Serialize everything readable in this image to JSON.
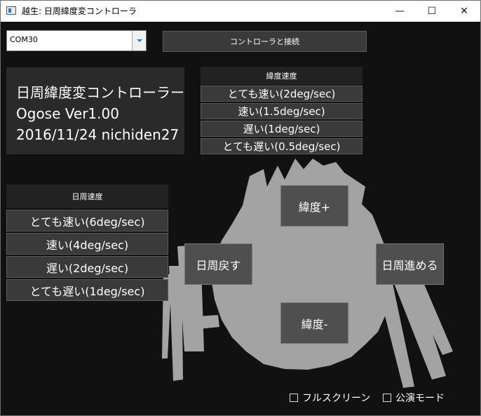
{
  "window": {
    "title": "越生: 日周緯度変コントローラ",
    "controls": {
      "minimize": "—",
      "maximize": "☐",
      "close": "✕"
    }
  },
  "port_select": {
    "value": "COM30"
  },
  "connect": {
    "label": "コントローラと接続"
  },
  "info": {
    "line1": "日周緯度変コントローラー",
    "line2": "Ogose Ver1.00",
    "line3": "2016/11/24 nichiden27"
  },
  "latitude": {
    "heading": "緯度速度",
    "options": [
      "とても速い(2deg/sec)",
      "速い(1.5deg/sec)",
      "遅い(1deg/sec)",
      "とても遅い(0.5deg/sec)"
    ]
  },
  "diurnal": {
    "heading": "日周速度",
    "options": [
      "とても速い(6deg/sec)",
      "速い(4deg/sec)",
      "遅い(2deg/sec)",
      "とても遅い(1deg/sec)"
    ]
  },
  "controls": {
    "lat_plus": "緯度+",
    "lat_minus": "緯度-",
    "day_back": "日周戻す",
    "day_forward": "日周進める"
  },
  "checkboxes": {
    "fullscreen": "フルスクリーン",
    "performance": "公演モード"
  },
  "icons": [
    "app-icon",
    "dropdown-arrow-icon",
    "minimize-icon",
    "maximize-icon",
    "close-icon"
  ]
}
